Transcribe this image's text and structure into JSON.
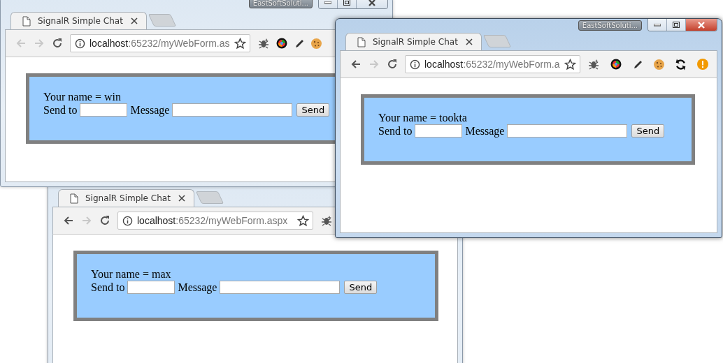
{
  "windows": [
    {
      "active": false,
      "taskbar_label": "EastSoftSoluti...",
      "tab": {
        "title": "SignalR Simple Chat"
      },
      "back_enabled": false,
      "forward_enabled": false,
      "url": {
        "host": "localhost",
        "path": ":65232/myWebForm.as"
      },
      "extensions": [
        {
          "kind": "bug"
        },
        {
          "kind": "ball"
        },
        {
          "kind": "pen"
        },
        {
          "kind": "cookie"
        }
      ],
      "form": {
        "your_name": "Your name = win",
        "send_to_label": "Send to",
        "message_label": "Message",
        "send_button": "Send"
      }
    },
    {
      "active": true,
      "taskbar_label": "EastSoftSoluti...",
      "tab": {
        "title": "SignalR Simple Chat"
      },
      "back_enabled": true,
      "forward_enabled": false,
      "url": {
        "host": "localhost",
        "path": ":65232/myWebForm.a"
      },
      "extensions": [
        {
          "kind": "bug"
        },
        {
          "kind": "ball"
        },
        {
          "kind": "pen"
        },
        {
          "kind": "cookie"
        },
        {
          "kind": "sync"
        },
        {
          "kind": "warning"
        }
      ],
      "form": {
        "your_name": "Your name = tookta",
        "send_to_label": "Send to",
        "message_label": "Message",
        "send_button": "Send"
      }
    },
    {
      "active": false,
      "tab": {
        "title": "SignalR Simple Chat"
      },
      "back_enabled": true,
      "forward_enabled": false,
      "url": {
        "host": "localhost",
        "path": ":65232/myWebForm.aspx"
      },
      "extensions": [
        {
          "kind": "bug"
        }
      ],
      "form": {
        "your_name": "Your name = max",
        "send_to_label": "Send to",
        "message_label": "Message",
        "send_button": "Send"
      }
    }
  ]
}
